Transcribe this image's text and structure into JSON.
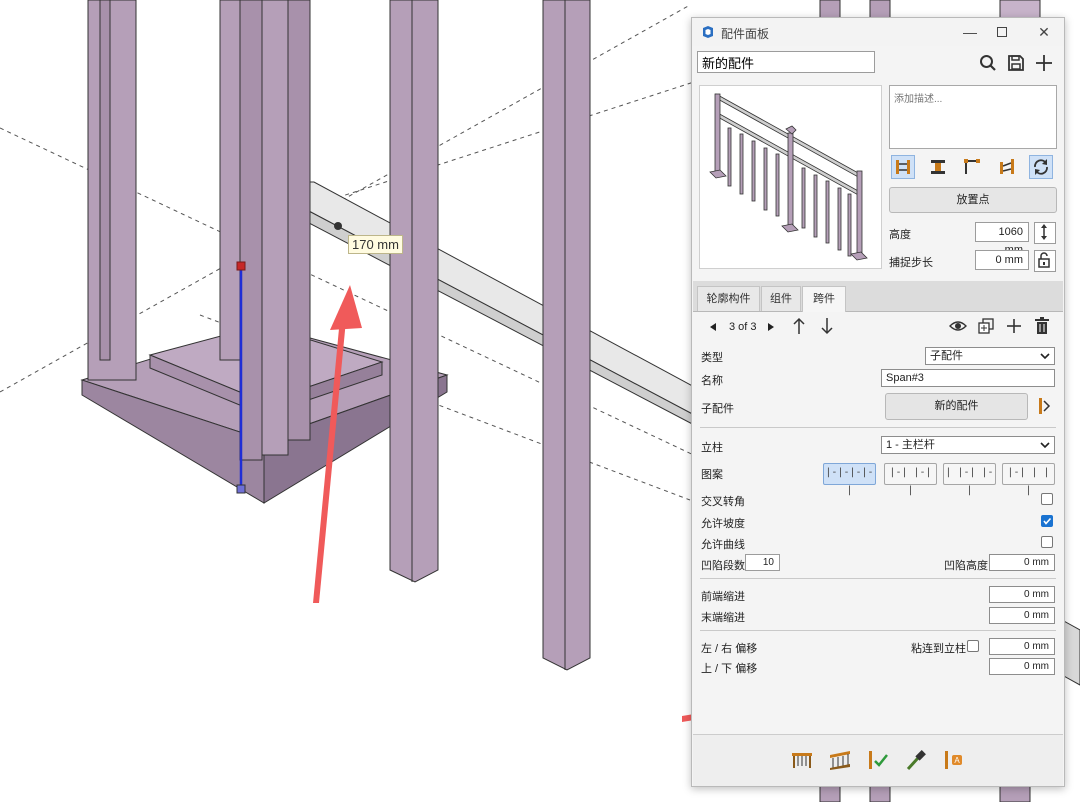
{
  "viewport": {
    "dimension_label": "170 mm"
  },
  "panel": {
    "title": "配件面板",
    "window_controls": [
      "minimize-icon",
      "maximize-icon",
      "close-icon"
    ],
    "name_value": "新的配件",
    "header_icons": [
      "search-icon",
      "save-icon",
      "plus-icon"
    ],
    "description_placeholder": "添加描述...",
    "mode_buttons": [
      {
        "icon": "span-both-posts-icon",
        "active": true
      },
      {
        "icon": "i-beam-icon",
        "active": false
      },
      {
        "icon": "corner-icon",
        "active": false
      },
      {
        "icon": "flip-icon",
        "active": false
      },
      {
        "icon": "refresh-icon",
        "active": true
      }
    ],
    "place_point_label": "放置点",
    "height_label": "高度",
    "height_value": "1060 mm",
    "snap_label": "捕捉步长",
    "snap_value": "0 mm",
    "tabs": [
      {
        "label": "轮廓构件",
        "active": false
      },
      {
        "label": "组件",
        "active": false
      },
      {
        "label": "跨件",
        "active": true
      }
    ],
    "nav": {
      "prev_icon": "triangle-left-icon",
      "page_text": "3 of 3",
      "next_icon": "triangle-right-icon",
      "move_up_icon": "arrow-up-icon",
      "move_down_icon": "arrow-down-icon",
      "right_icons": [
        "eye-icon",
        "duplicate-icon",
        "plus-icon",
        "trash-icon"
      ]
    },
    "type_label": "类型",
    "type_value": "子配件",
    "name_label": "名称",
    "span_name": "Span#3",
    "sub_assembly_label": "子配件",
    "sub_assembly_button": "新的配件",
    "post_label": "立柱",
    "post_value": "1 - 主栏杆",
    "pattern_label": "图案",
    "patterns": [
      {
        "text": "|-|-|-|-|",
        "active": true
      },
      {
        "text": "|-| |-| |",
        "active": false
      },
      {
        "text": "| |-| |-|",
        "active": false
      },
      {
        "text": "|-| | | |",
        "active": false
      }
    ],
    "cross_corner_label": "交叉转角",
    "cross_corner_checked": false,
    "allow_slope_label": "允许坡度",
    "allow_slope_checked": true,
    "allow_curve_label": "允许曲线",
    "allow_curve_checked": false,
    "recess_count_label": "凹陷段数",
    "recess_count_value": "10",
    "recess_height_label": "凹陷高度",
    "recess_height_value": "0 mm",
    "front_inset_label": "前端缩进",
    "front_inset_value": "0 mm",
    "end_inset_label": "末端缩进",
    "end_inset_value": "0 mm",
    "lr_offset_label": "左 / 右 偏移",
    "stick_to_post_label": "粘连到立柱",
    "stick_to_post_checked": false,
    "lr_offset_value": "0 mm",
    "ud_offset_label": "上 / 下 偏移",
    "ud_offset_value": "0 mm",
    "bottom_tools": [
      "railing-draw-icon",
      "railing-stair-icon",
      "railing-check-icon",
      "eyedropper-icon",
      "attribute-icon"
    ]
  },
  "colors": {
    "post_fill": "#b59fb8",
    "post_stroke": "#333333",
    "rail_fill": "#e4e4e4",
    "annotation_arrow": "#f05a5a",
    "dimension_line": "#1f2dd6",
    "active_blue": "#cfe1f7",
    "checkbox_blue": "#1a73d1"
  }
}
